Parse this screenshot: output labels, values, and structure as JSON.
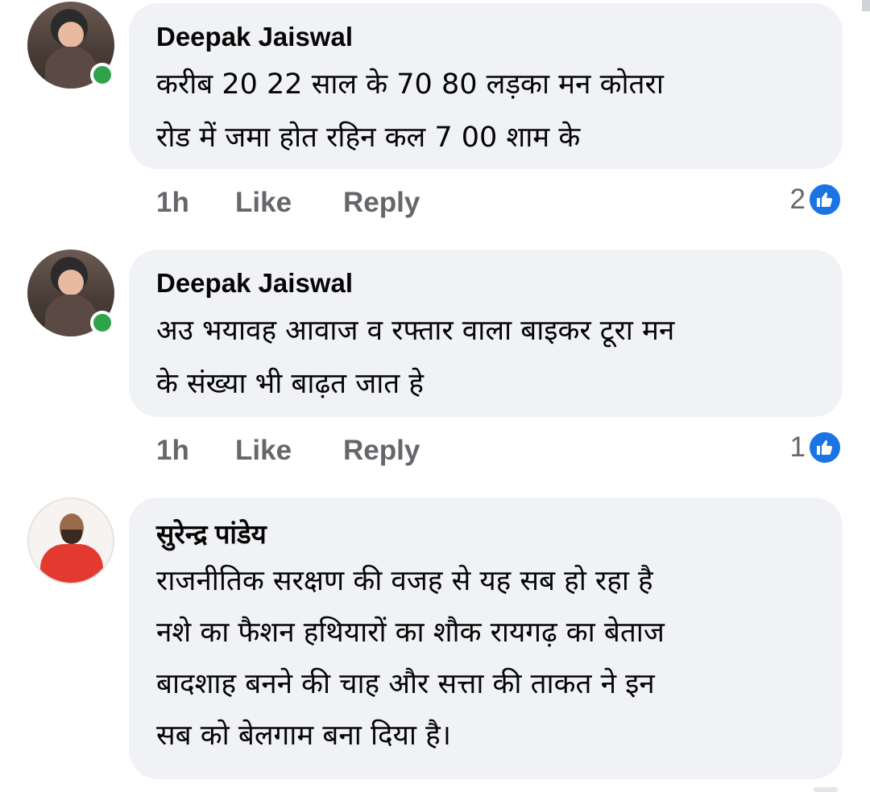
{
  "comments": [
    {
      "author": "Deepak Jaiswal",
      "lines": "करीब 20 22 साल के 70 80 लड़का मन कोतरा\nरोड में जमा होत रहिन कल 7 00 शाम के",
      "time": "1h",
      "like_label": "Like",
      "reply_label": "Reply",
      "reaction_count": "2",
      "online": true
    },
    {
      "author": "Deepak Jaiswal",
      "lines": "अउ भयावह आवाज व रफ्तार वाला बाइकर टूरा मन\nके संख्या भी बाढ़त जात हे",
      "time": "1h",
      "like_label": "Like",
      "reply_label": "Reply",
      "reaction_count": "1",
      "online": true
    },
    {
      "author": "सुरेन्द्र पांडेय",
      "lines": "राजनीतिक सरक्षण की वजह से यह सब हो रहा है\nनशे का फैशन हथियारों का शौक रायगढ़ का बेताज\nबादशाह बनने की चाह और सत्ता की ताकत ने इन\nसब को बेलगाम बना दिया है।",
      "online": false
    }
  ],
  "colors": {
    "bubble": "#f0f2f5",
    "meta_text": "#65676b",
    "like_badge": "#1b74e4",
    "online_dot": "#31a24c"
  },
  "icons": [
    "like-thumb-icon",
    "online-status-dot"
  ]
}
